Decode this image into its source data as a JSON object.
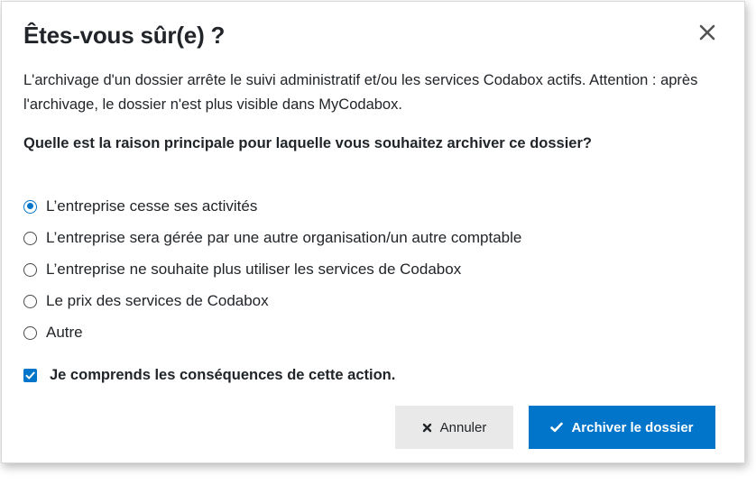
{
  "dialog": {
    "title": "Êtes-vous sûr(e) ?",
    "close_icon": "close-icon",
    "description": "L'archivage d'un dossier arrête le suivi administratif et/ou les services Codabox actifs. Attention : après l'archivage, le dossier n'est plus visible dans MyCodabox.",
    "question": "Quelle est la raison principale pour laquelle vous souhaitez archiver ce dossier?",
    "reasons": [
      {
        "label": "L’entreprise cesse ses activités",
        "selected": true
      },
      {
        "label": "L’entreprise sera gérée par une autre organisation/un autre comptable",
        "selected": false
      },
      {
        "label": "L’entreprise ne souhaite plus utiliser les services de Codabox",
        "selected": false
      },
      {
        "label": "Le prix des services de Codabox",
        "selected": false
      },
      {
        "label": "Autre",
        "selected": false
      }
    ],
    "confirmation": {
      "label": "Je comprends les conséquences de cette action.",
      "checked": true
    },
    "buttons": {
      "cancel_label": "Annuler",
      "cancel_icon": "x-icon",
      "archive_label": "Archiver le dossier",
      "archive_icon": "checkmark-icon"
    }
  },
  "colors": {
    "accent": "#0075c9",
    "text": "#212529",
    "cancel_bg": "#e9e9e9"
  }
}
